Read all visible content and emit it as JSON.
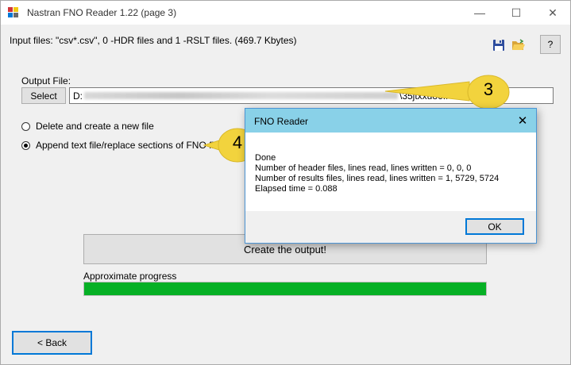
{
  "window": {
    "title": "Nastran FNO Reader 1.22  (page 3)",
    "controls": {
      "minimize": "—",
      "maximize": "☐",
      "close": "✕"
    }
  },
  "status_text": "Input files: \"csv*.csv\", 0 -HDR files and 1 -RSLT files. (469.7 Kbytes)",
  "toolbar": {
    "save_icon": "floppy-disk-icon",
    "open_icon": "folder-open-icon",
    "help_label": "?"
  },
  "output": {
    "label": "Output File:",
    "select_label": "Select",
    "path_prefix": "D:",
    "path_suffix": "\\35jtxxu86.FNO"
  },
  "options": {
    "delete_create": "Delete and create a new file",
    "append": "Append text file/replace sections of FNO file",
    "selected": "append"
  },
  "callouts": {
    "a": "3",
    "b": "4"
  },
  "create_label": "Create the output!",
  "progress": {
    "label": "Approximate progress",
    "value": 1.0
  },
  "back_label": "< Back",
  "dialog": {
    "title": "FNO Reader",
    "lines": [
      "Done",
      "Number of header files, lines read, lines written = 0, 0, 0",
      "Number of results files, lines read, lines written = 1, 5729, 5724",
      "Elapsed time = 0.088"
    ],
    "ok_label": "OK"
  },
  "colors": {
    "accent": "#0078d7",
    "progress": "#06b025",
    "dialog_title": "#89d1e8",
    "callout": "#f2d33d"
  }
}
